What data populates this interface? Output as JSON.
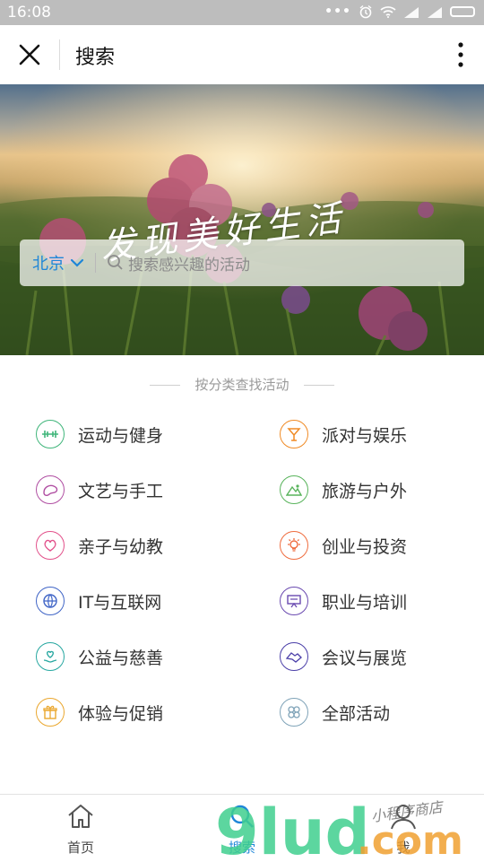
{
  "status_bar": {
    "time": "16:08",
    "dots": "•••"
  },
  "nav": {
    "title": "搜索",
    "close_icon": "close-icon",
    "more_icon": "more-vertical-icon"
  },
  "hero": {
    "slogan": "发现美好生活",
    "city": "北京",
    "search_placeholder": "搜索感兴趣的活动"
  },
  "section_title": "按分类查找活动",
  "categories": [
    {
      "label": "运动与健身",
      "icon": "dumbbell-icon",
      "color": "#3fb57a"
    },
    {
      "label": "派对与娱乐",
      "icon": "cocktail-icon",
      "color": "#f08a24"
    },
    {
      "label": "文艺与手工",
      "icon": "palette-icon",
      "color": "#b04ea2"
    },
    {
      "label": "旅游与户外",
      "icon": "mountain-icon",
      "color": "#58b35b"
    },
    {
      "label": "亲子与幼教",
      "icon": "heart-hand-icon",
      "color": "#e2508a"
    },
    {
      "label": "创业与投资",
      "icon": "lightbulb-icon",
      "color": "#ef6c3e"
    },
    {
      "label": "IT与互联网",
      "icon": "globe-icon",
      "color": "#3f64c6"
    },
    {
      "label": "职业与培训",
      "icon": "presentation-icon",
      "color": "#6a4ab0"
    },
    {
      "label": "公益与慈善",
      "icon": "charity-heart-icon",
      "color": "#26a7a0"
    },
    {
      "label": "会议与展览",
      "icon": "handshake-icon",
      "color": "#4a3ea8"
    },
    {
      "label": "体验与促销",
      "icon": "gift-icon",
      "color": "#eaa72e"
    },
    {
      "label": "全部活动",
      "icon": "clover-icon",
      "color": "#7fa3b8"
    }
  ],
  "tabs": [
    {
      "label": "首页",
      "icon": "home-icon"
    },
    {
      "label": "搜索",
      "icon": "search-icon"
    },
    {
      "label": "我",
      "icon": "user-icon"
    }
  ],
  "watermark": {
    "text": "9lud",
    "suffix": ".com",
    "tagline": "小程序商店"
  }
}
